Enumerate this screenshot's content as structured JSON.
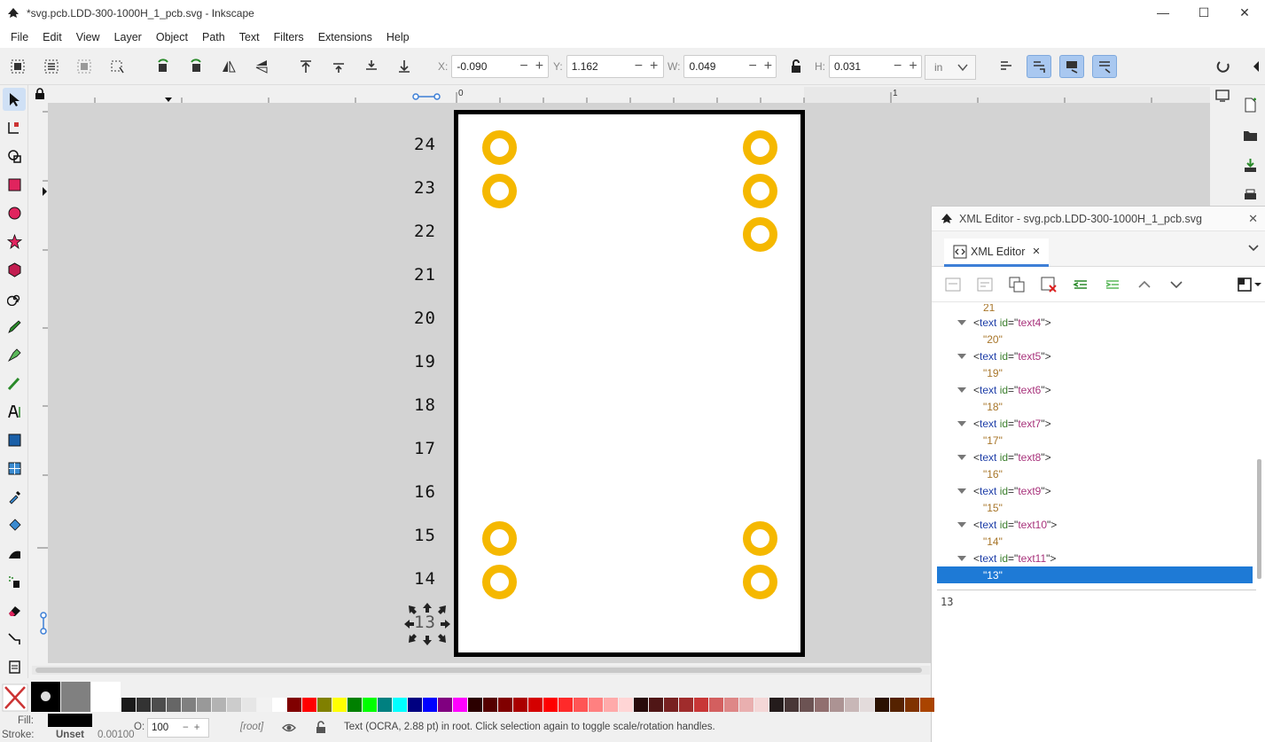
{
  "window": {
    "title": "*svg.pcb.LDD-300-1000H_1_pcb.svg - Inkscape",
    "minimize": "—",
    "maximize": "☐",
    "close": "✕"
  },
  "menu": [
    "File",
    "Edit",
    "View",
    "Layer",
    "Object",
    "Path",
    "Text",
    "Filters",
    "Extensions",
    "Help"
  ],
  "toolbar": {
    "x_label": "X:",
    "x_value": "-0.090",
    "y_label": "Y:",
    "y_value": "1.162",
    "w_label": "W:",
    "w_value": "0.049",
    "h_label": "H:",
    "h_value": "0.031",
    "unit": "in",
    "minus": "−",
    "plus": "+"
  },
  "ruler": {
    "zero": "0",
    "one": "1"
  },
  "canvas": {
    "pin_numbers": [
      "24",
      "23",
      "22",
      "21",
      "20",
      "19",
      "18",
      "17",
      "16",
      "15",
      "14"
    ],
    "selected_text": "13",
    "pad_color": "#f5b800"
  },
  "xml_editor": {
    "title": "XML Editor - svg.pcb.LDD-300-1000H_1_pcb.svg",
    "tab_label": "XML Editor",
    "tab_close": "✕",
    "partial_top": "21",
    "nodes": [
      {
        "tag": "text",
        "attr": "id",
        "value": "text4",
        "content": "\"20\""
      },
      {
        "tag": "text",
        "attr": "id",
        "value": "text5",
        "content": "\"19\""
      },
      {
        "tag": "text",
        "attr": "id",
        "value": "text6",
        "content": "\"18\""
      },
      {
        "tag": "text",
        "attr": "id",
        "value": "text7",
        "content": "\"17\""
      },
      {
        "tag": "text",
        "attr": "id",
        "value": "text8",
        "content": "\"16\""
      },
      {
        "tag": "text",
        "attr": "id",
        "value": "text9",
        "content": "\"15\""
      },
      {
        "tag": "text",
        "attr": "id",
        "value": "text10",
        "content": "\"14\""
      },
      {
        "tag": "text",
        "attr": "id",
        "value": "text11",
        "content": "\"13\""
      }
    ],
    "text_content": "13"
  },
  "status": {
    "fill_label": "Fill:",
    "stroke_label": "Stroke:",
    "stroke_value": "Unset",
    "stroke_width": "0.00100",
    "opacity_label": "O:",
    "opacity_value": "100",
    "layer": "[root]",
    "message_strong": "Text",
    "message_rest": " (OCRA, 2.88 pt) in root. Click selection again to toggle scale/rotation handles."
  },
  "palette": [
    "#1a1a1a",
    "#333333",
    "#4d4d4d",
    "#666666",
    "#808080",
    "#999999",
    "#b3b3b3",
    "#cccccc",
    "#e6e6e6",
    "#f2f2f2",
    "#ffffff",
    "#800000",
    "#ff0000",
    "#808000",
    "#ffff00",
    "#008000",
    "#00ff00",
    "#008080",
    "#00ffff",
    "#000080",
    "#0000ff",
    "#800080",
    "#ff00ff",
    "#2b0000",
    "#550000",
    "#800000",
    "#aa0000",
    "#d40000",
    "#ff0000",
    "#ff2a2a",
    "#ff5555",
    "#ff8080",
    "#ffaaaa",
    "#ffd5d5",
    "#280b0b",
    "#501616",
    "#782121",
    "#a02c2c",
    "#c83737",
    "#d35f5f",
    "#de8787",
    "#e9afaf",
    "#f4d7d7",
    "#241c1c",
    "#483737",
    "#6c5353",
    "#916f6f",
    "#ac9393",
    "#c8b7b7",
    "#e3dbdb",
    "#2b1100",
    "#552200",
    "#803300",
    "#aa4400"
  ]
}
